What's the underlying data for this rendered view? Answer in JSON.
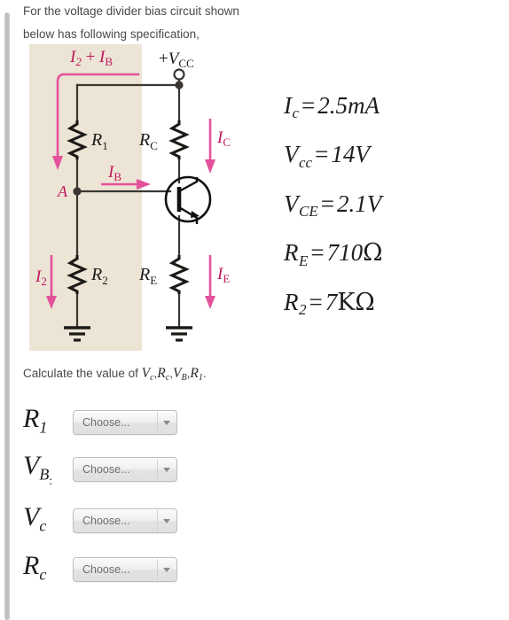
{
  "question": {
    "line1": "For the voltage divider bias circuit shown",
    "line2": "below has following specification,"
  },
  "circuit": {
    "background_color": "#ece4d5",
    "wire_color": "#3a3632",
    "current_color": "#e3519b",
    "label_color": "#c0175b",
    "labels": {
      "vcc": "+V",
      "vcc_sub": "CC",
      "i2_ib": "I₂ + I",
      "i2_ib_sub": "B",
      "r1": "R",
      "r1_sub": "1",
      "r2": "R",
      "r2_sub": "2",
      "rc": "R",
      "rc_sub": "C",
      "re": "R",
      "re_sub": "E",
      "ic": "I",
      "ic_sub": "C",
      "ie": "I",
      "ie_sub": "E",
      "ib": "I",
      "ib_sub": "B",
      "i2": "I",
      "i2_sub": "2",
      "node_a": "A"
    }
  },
  "equations": [
    {
      "id": "ic",
      "lhs": "I",
      "lhs_sub": "c",
      "value": "2.5",
      "unit": "mA"
    },
    {
      "id": "vcc",
      "lhs": "V",
      "lhs_sub": "cc",
      "value": "14",
      "unit": "V"
    },
    {
      "id": "vce",
      "lhs": "V",
      "lhs_sub": "CE",
      "value": "2.1",
      "unit": "V"
    },
    {
      "id": "re",
      "lhs": "R",
      "lhs_sub": "E",
      "value": "710",
      "unit": "Ω"
    },
    {
      "id": "r2",
      "lhs": "R",
      "lhs_sub": "2",
      "value": "7",
      "unit": "KΩ"
    }
  ],
  "calculate": {
    "prefix": "Calculate the value of ",
    "vars": [
      {
        "base": "V",
        "sub": "c"
      },
      {
        "base": "R",
        "sub": "c"
      },
      {
        "base": "V",
        "sub": "B"
      },
      {
        "base": "R",
        "sub": "1"
      }
    ],
    "separator": ",",
    "suffix": "."
  },
  "answers": [
    {
      "label_base": "R",
      "label_sub": "1",
      "label_tail": "",
      "select_value": "Choose..."
    },
    {
      "label_base": "V",
      "label_sub": "B",
      "label_tail": ":",
      "select_value": "Choose..."
    },
    {
      "label_base": "V",
      "label_sub": "c",
      "label_tail": "",
      "select_value": "Choose..."
    },
    {
      "label_base": "R",
      "label_sub": "c",
      "label_tail": "",
      "select_value": "Choose..."
    }
  ]
}
